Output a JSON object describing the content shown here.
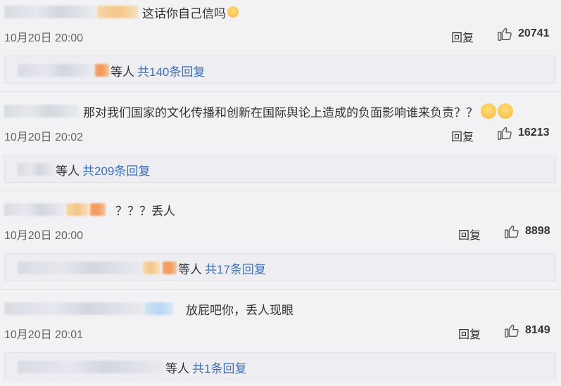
{
  "comments": [
    {
      "text": "这话你自己信吗",
      "time": "10月20日 20:00",
      "reply_label": "回复",
      "likes": "20741",
      "sub": {
        "suffix": "等人",
        "more": "共140条回复"
      }
    },
    {
      "text": "那对我们国家的文化传播和创新在国际舆论上造成的负面影响谁来负责？？",
      "time": "10月20日 20:02",
      "reply_label": "回复",
      "likes": "16213",
      "sub": {
        "suffix": "等人",
        "more": "共209条回复"
      }
    },
    {
      "text": "？？？丢人",
      "time": "10月20日 20:00",
      "reply_label": "回复",
      "likes": "8898",
      "sub": {
        "suffix": "等人",
        "more": "共17条回复"
      }
    },
    {
      "text": "放屁吧你，丢人现眼",
      "time": "10月20日 20:01",
      "reply_label": "回复",
      "likes": "8149",
      "sub": {
        "suffix": "等人",
        "more": "共1条回复"
      }
    }
  ],
  "icons": {
    "like": "thumbs-up-icon",
    "emoji": "emoji-icon"
  },
  "colors": {
    "link": "#3d6fb6",
    "background": "#f2f2f5"
  }
}
